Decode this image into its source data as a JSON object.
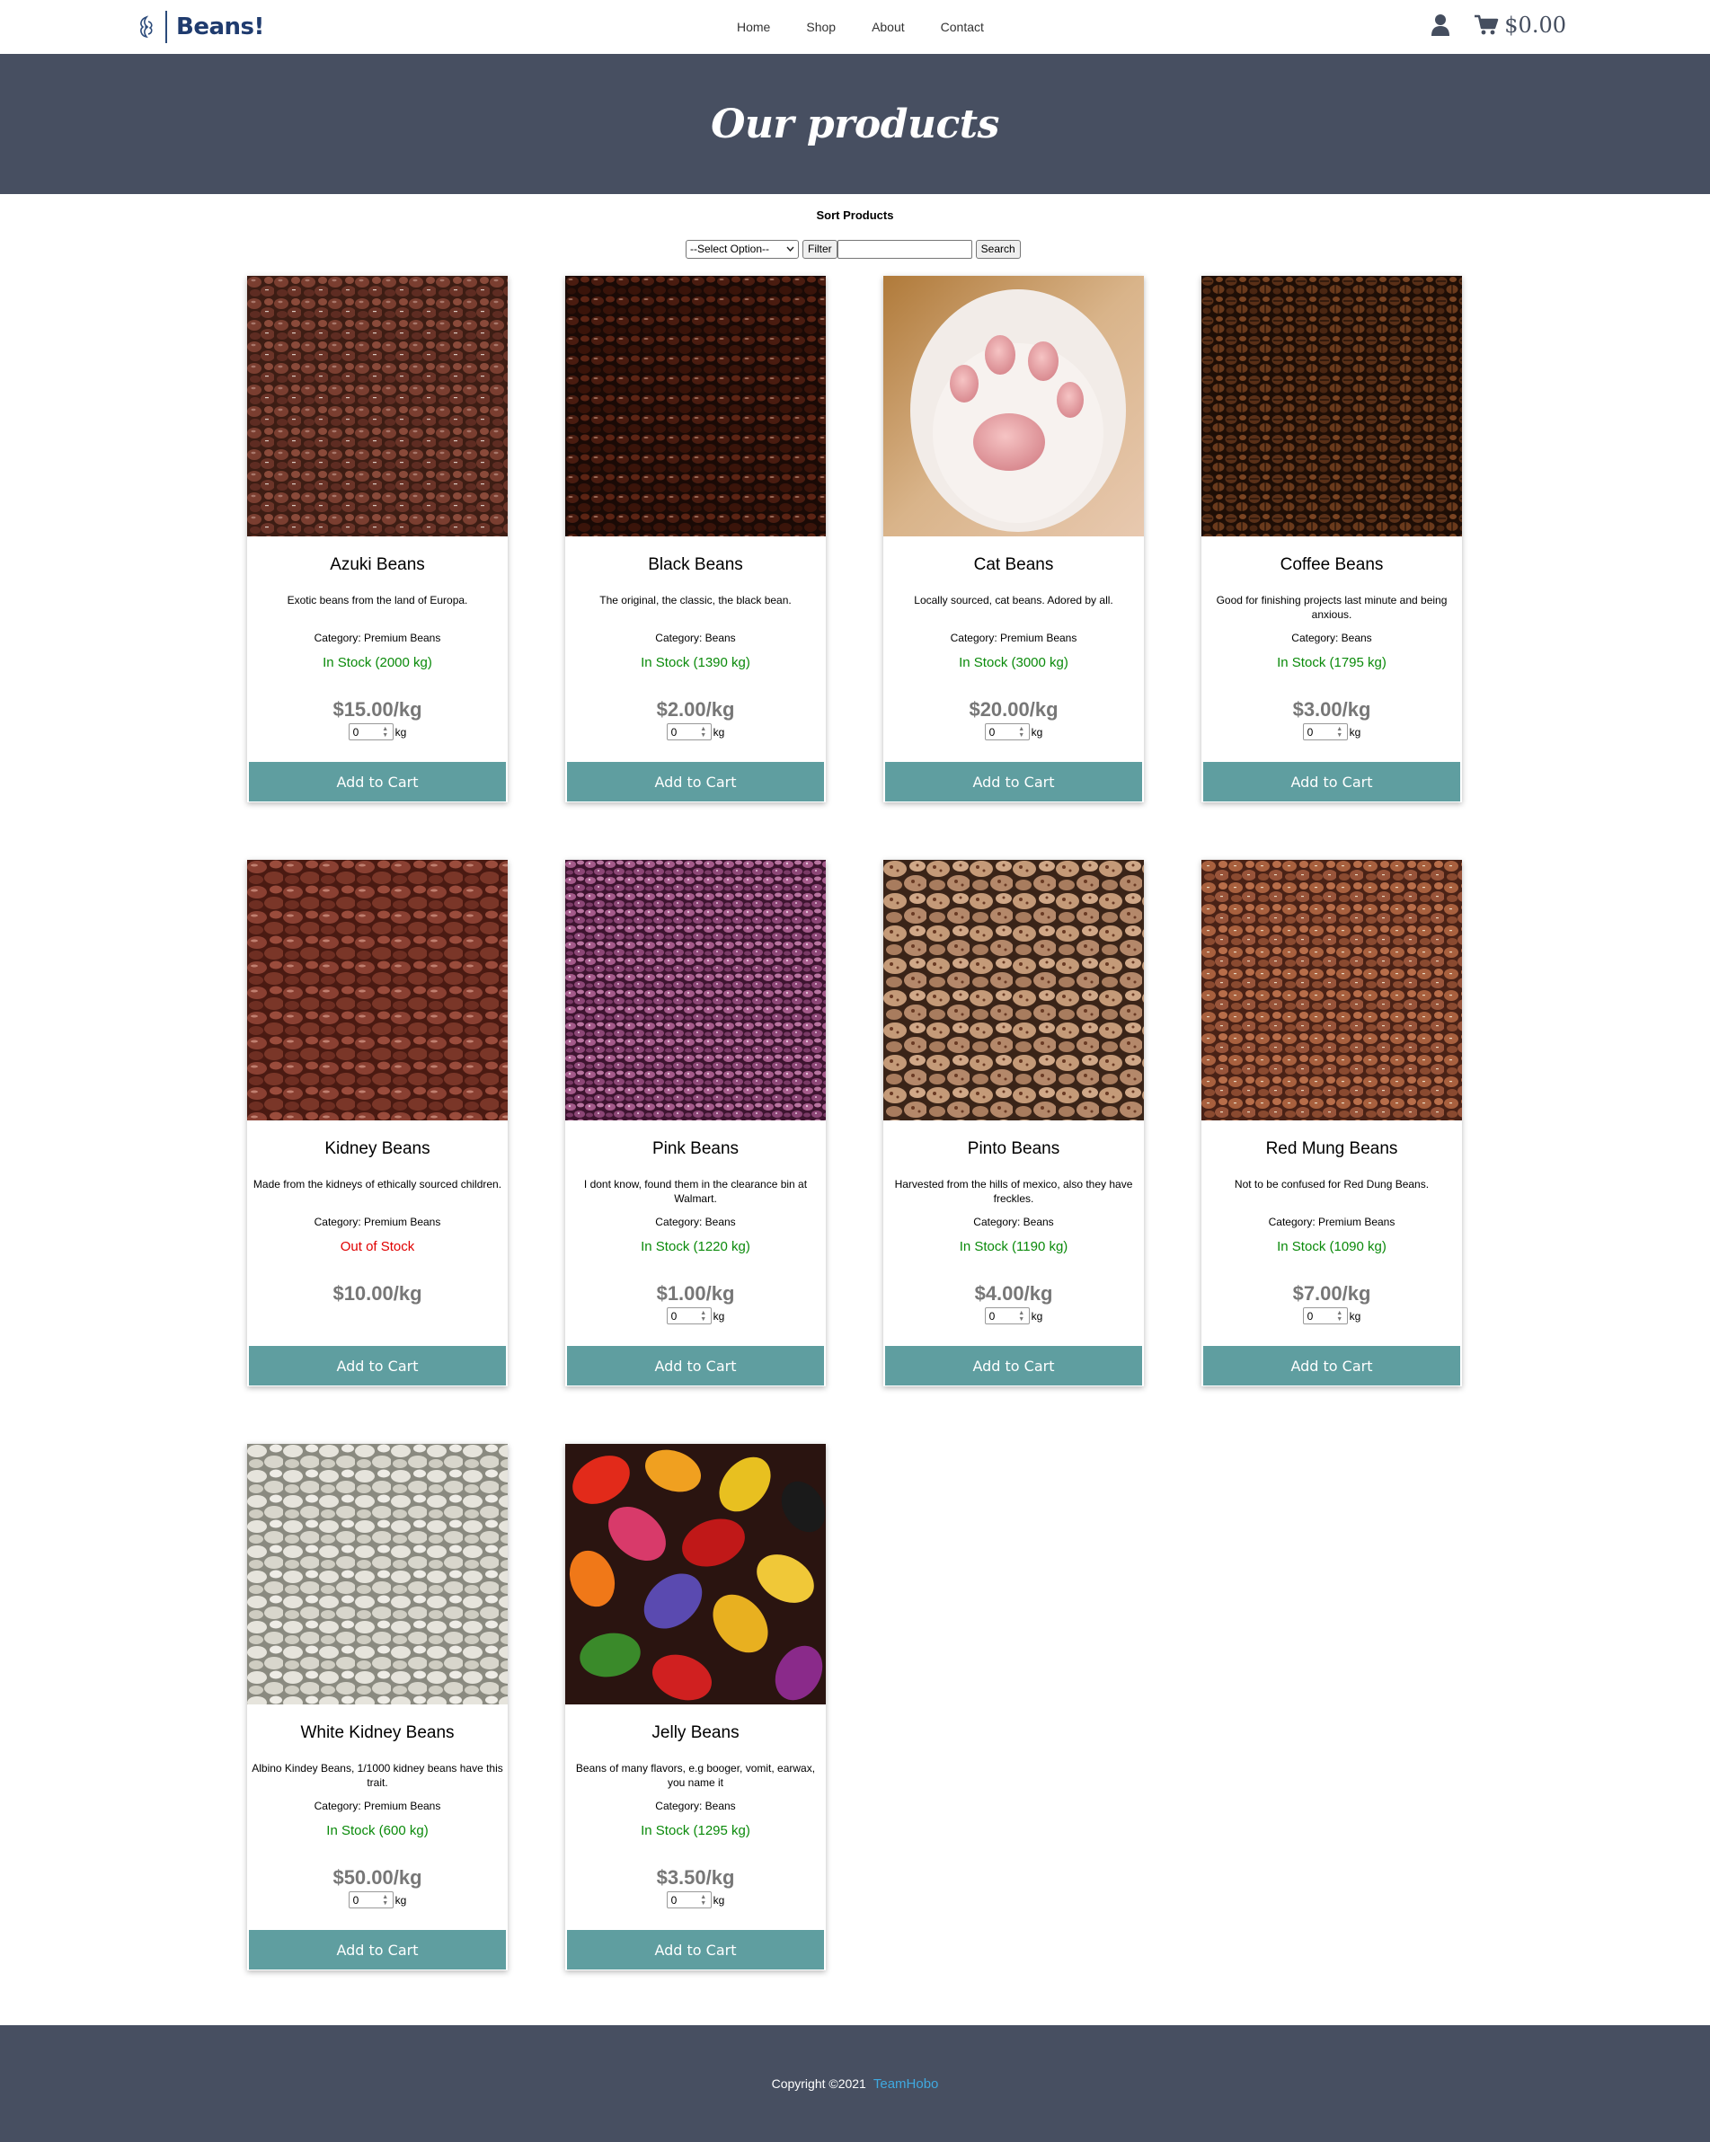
{
  "header": {
    "brand": "Beans!",
    "nav": [
      "Home",
      "Shop",
      "About",
      "Contact"
    ],
    "cart_total": "$0.00"
  },
  "hero": {
    "title": "Our products"
  },
  "sort": {
    "title": "Sort Products",
    "select_value": "--Select Option--",
    "filter_label": "Filter",
    "search_value": "",
    "search_label": "Search"
  },
  "products": [
    {
      "name": "Azuki Beans",
      "description": "Exotic beans from the land of Europa.",
      "category": "Category: Premium Beans",
      "stock": "In Stock (2000 kg)",
      "in_stock": true,
      "price": "$15.00/kg",
      "qty": "0",
      "unit": "kg",
      "button": "Add to Cart",
      "image": "azuki-beans-photo"
    },
    {
      "name": "Black Beans",
      "description": "The original, the classic, the black bean.",
      "category": "Category: Beans",
      "stock": "In Stock (1390 kg)",
      "in_stock": true,
      "price": "$2.00/kg",
      "qty": "0",
      "unit": "kg",
      "button": "Add to Cart",
      "image": "black-beans-photo"
    },
    {
      "name": "Cat Beans",
      "description": "Locally sourced, cat beans. Adored by all.",
      "category": "Category: Premium Beans",
      "stock": "In Stock (3000 kg)",
      "in_stock": true,
      "price": "$20.00/kg",
      "qty": "0",
      "unit": "kg",
      "button": "Add to Cart",
      "image": "cat-paw-photo"
    },
    {
      "name": "Coffee Beans",
      "description": "Good for finishing projects last minute and being anxious.",
      "category": "Category: Beans",
      "stock": "In Stock (1795 kg)",
      "in_stock": true,
      "price": "$3.00/kg",
      "qty": "0",
      "unit": "kg",
      "button": "Add to Cart",
      "image": "coffee-beans-photo"
    },
    {
      "name": "Kidney Beans",
      "description": "Made from the kidneys of ethically sourced children.",
      "category": "Category: Premium Beans",
      "stock": "Out of Stock",
      "in_stock": false,
      "price": "$10.00/kg",
      "qty": "",
      "unit": "",
      "button": "Add to Cart",
      "image": "kidney-beans-photo"
    },
    {
      "name": "Pink Beans",
      "description": "I dont know, found them in the clearance bin at Walmart.",
      "category": "Category: Beans",
      "stock": "In Stock (1220 kg)",
      "in_stock": true,
      "price": "$1.00/kg",
      "qty": "0",
      "unit": "kg",
      "button": "Add to Cart",
      "image": "pink-beans-photo"
    },
    {
      "name": "Pinto Beans",
      "description": "Harvested from the hills of mexico, also they have freckles.",
      "category": "Category: Beans",
      "stock": "In Stock (1190 kg)",
      "in_stock": true,
      "price": "$4.00/kg",
      "qty": "0",
      "unit": "kg",
      "button": "Add to Cart",
      "image": "pinto-beans-photo"
    },
    {
      "name": "Red Mung Beans",
      "description": "Not to be confused for Red Dung Beans.",
      "category": "Category: Premium Beans",
      "stock": "In Stock (1090 kg)",
      "in_stock": true,
      "price": "$7.00/kg",
      "qty": "0",
      "unit": "kg",
      "button": "Add to Cart",
      "image": "red-mung-beans-photo"
    },
    {
      "name": "White Kidney Beans",
      "description": "Albino Kindey Beans, 1/1000 kidney beans have this trait.",
      "category": "Category: Premium Beans",
      "stock": "In Stock (600 kg)",
      "in_stock": true,
      "price": "$50.00/kg",
      "qty": "0",
      "unit": "kg",
      "button": "Add to Cart",
      "image": "white-kidney-beans-photo"
    },
    {
      "name": "Jelly Beans",
      "description": "Beans of many flavors, e.g booger, vomit, earwax, you name it",
      "category": "Category: Beans",
      "stock": "In Stock (1295 kg)",
      "in_stock": true,
      "price": "$3.50/kg",
      "qty": "0",
      "unit": "kg",
      "button": "Add to Cart",
      "image": "jelly-beans-photo"
    }
  ],
  "footer": {
    "copyright": "Copyright ©2021",
    "link": "TeamHobo"
  },
  "colors": {
    "hero_bg": "#474f61",
    "button_bg": "#5f9ea0",
    "in_stock": "#0a8a0a",
    "out_of_stock": "#e00000",
    "brand": "#1f3b6e",
    "footer_link": "#3fa9e0"
  }
}
